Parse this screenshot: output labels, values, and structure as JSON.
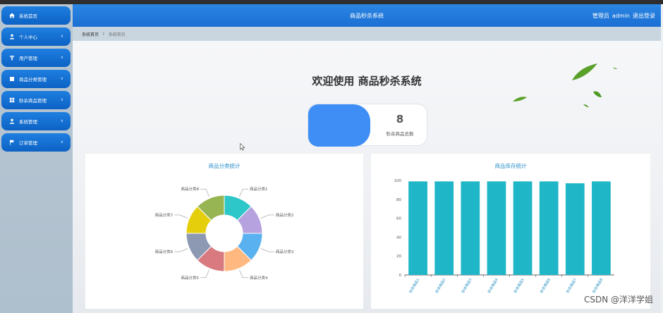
{
  "header": {
    "title": "商品秒杀系统",
    "user_role": "管理员",
    "user_name": "admin",
    "logout": "退出登录"
  },
  "sidebar": {
    "items": [
      {
        "label": "系统首页",
        "icon": "home-icon",
        "has_chevron": false
      },
      {
        "label": "个人中心",
        "icon": "user-icon",
        "has_chevron": true
      },
      {
        "label": "用户管理",
        "icon": "user-manage-icon",
        "has_chevron": true
      },
      {
        "label": "商品分类管理",
        "icon": "category-icon",
        "has_chevron": true
      },
      {
        "label": "秒杀商品管理",
        "icon": "grid-icon",
        "has_chevron": true
      },
      {
        "label": "系统管理",
        "icon": "user-icon",
        "has_chevron": true
      },
      {
        "label": "订单管理",
        "icon": "flag-icon",
        "has_chevron": true
      }
    ]
  },
  "breadcrumb": {
    "home": "系统首页",
    "separator": "I",
    "current": "系统首页"
  },
  "welcome": "欢迎使用 商品秒杀系统",
  "stat": {
    "value": "8",
    "label": "秒杀商品总数"
  },
  "pie_panel": {
    "title": "商品分类统计"
  },
  "bar_panel": {
    "title": "商品库存统计"
  },
  "chart_data": [
    {
      "type": "pie",
      "title": "商品分类统计",
      "categories": [
        "商品分类1",
        "商品分类2",
        "商品分类3",
        "商品分类4",
        "商品分类5",
        "商品分类6",
        "商品分类7",
        "商品分类8"
      ],
      "values": [
        1,
        1,
        1,
        1,
        1,
        1,
        1,
        1
      ],
      "colors": [
        "#2ec7c9",
        "#b6a2de",
        "#5ab1ef",
        "#ffb980",
        "#d87a80",
        "#8d98b3",
        "#e5cf0d",
        "#97b552"
      ]
    },
    {
      "type": "bar",
      "title": "商品库存统计",
      "categories": [
        "秒杀商品1",
        "秒杀商品2",
        "秒杀商品3",
        "秒杀商品4",
        "秒杀商品5",
        "秒杀商品6",
        "秒杀商品7",
        "秒杀商品8"
      ],
      "values": [
        99,
        99,
        99,
        99,
        99,
        99,
        97,
        99
      ],
      "ylim": [
        0,
        100
      ],
      "yticks": [
        0,
        20,
        40,
        60,
        80,
        100
      ],
      "color": "#1fb6c8"
    }
  ],
  "watermark": "CSDN @洋洋学姐"
}
